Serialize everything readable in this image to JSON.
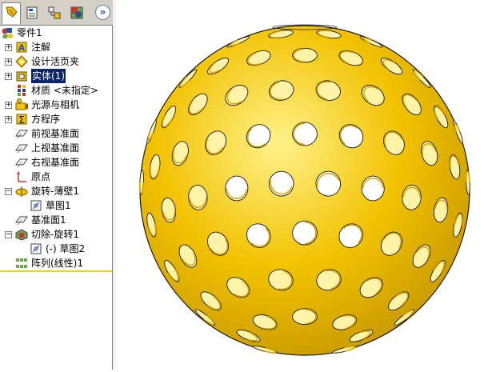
{
  "tabs": [
    {
      "name": "feature-manager",
      "icon": "feature-tree-icon"
    },
    {
      "name": "property-manager",
      "icon": "property-sheet-icon"
    },
    {
      "name": "configuration-manager",
      "icon": "configuration-icon"
    },
    {
      "name": "display-manager",
      "icon": "appearance-icon"
    }
  ],
  "collapse_glyph": "»",
  "tree": {
    "root": "零件1",
    "items": [
      {
        "label": "注解",
        "icon": "annotation-icon",
        "expandable": true
      },
      {
        "label": "设计活页夹",
        "icon": "design-binder-icon",
        "expandable": true
      },
      {
        "label": "实体(1)",
        "icon": "solid-body-icon",
        "expandable": true,
        "selected": true
      },
      {
        "label": "材质 <未指定>",
        "icon": "material-icon",
        "expandable": false
      },
      {
        "label": "光源与相机",
        "icon": "lights-camera-icon",
        "expandable": true
      },
      {
        "label": "方程序",
        "icon": "equation-icon",
        "expandable": true
      },
      {
        "label": "前视基准面",
        "icon": "plane-icon",
        "expandable": false
      },
      {
        "label": "上视基准面",
        "icon": "plane-icon",
        "expandable": false
      },
      {
        "label": "右视基准面",
        "icon": "plane-icon",
        "expandable": false
      },
      {
        "label": "原点",
        "icon": "origin-icon",
        "expandable": false
      },
      {
        "label": "旋转-薄壁1",
        "icon": "revolve-icon",
        "expandable": true,
        "expanded": true
      },
      {
        "label": "草图1",
        "icon": "sketch-icon",
        "expandable": false,
        "child": true
      },
      {
        "label": "基准面1",
        "icon": "plane-icon",
        "expandable": false
      },
      {
        "label": "切除-旋转1",
        "icon": "cut-revolve-icon",
        "expandable": true,
        "expanded": true
      },
      {
        "label": "(-) 草图2",
        "icon": "sketch-icon",
        "expandable": false,
        "child": true
      },
      {
        "label": "阵列(线性)1",
        "icon": "linear-pattern-icon",
        "expandable": false
      }
    ]
  },
  "model": {
    "body_color": "#f2c200",
    "highlight_color": "#fff28a",
    "shadow_color": "#c89a00",
    "hole_count_visible": 120
  }
}
